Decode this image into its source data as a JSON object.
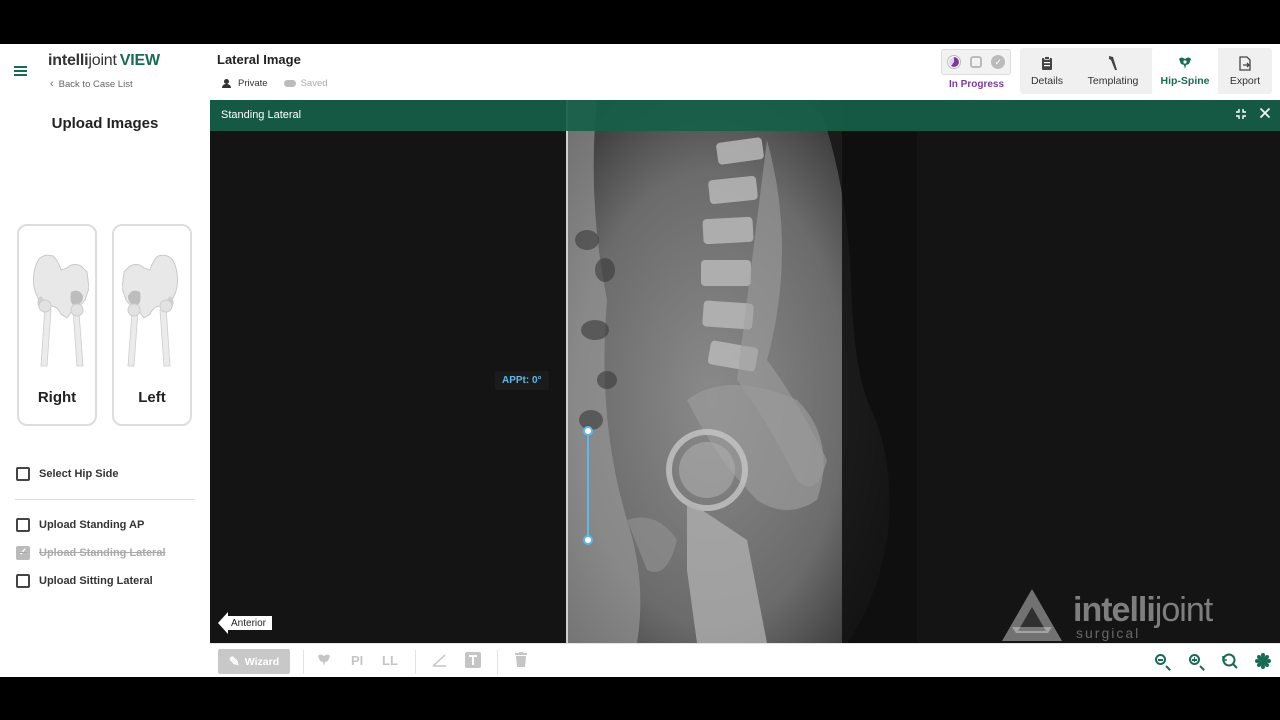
{
  "header": {
    "brand_bold": "intelli",
    "brand_light": "joint",
    "brand_view": "VIEW",
    "back_link": "Back to Case List",
    "doc_title": "Lateral Image",
    "privacy": "Private",
    "save_state": "Saved",
    "status": "In Progress",
    "tabs": [
      {
        "label": "Details",
        "icon": "clipboard-icon"
      },
      {
        "label": "Templating",
        "icon": "stem-icon"
      },
      {
        "label": "Hip-Spine",
        "icon": "hip-spine-icon"
      },
      {
        "label": "Export",
        "icon": "export-icon"
      }
    ],
    "active_tab": "Hip-Spine",
    "accent_color": "#1a6b55",
    "status_color": "#7a3c98"
  },
  "sidebar": {
    "title": "Upload Images",
    "hip_right": "Right",
    "hip_left": "Left",
    "checklist": [
      {
        "label": "Select Hip Side",
        "checked": false
      },
      {
        "label": "Upload Standing AP",
        "checked": false
      },
      {
        "label": "Upload Standing Lateral",
        "checked": true
      },
      {
        "label": "Upload Sitting Lateral",
        "checked": false
      }
    ]
  },
  "viewer": {
    "title": "Standing Lateral",
    "measurement": "APPt: 0°",
    "orientation": "Anterior",
    "watermark_bold": "intelli",
    "watermark_light": "joint",
    "watermark_sub": "surgical"
  },
  "toolbar": {
    "wizard": "Wizard",
    "pi": "PI",
    "ll": "LL",
    "tools": [
      "hip-tool-icon",
      "angle-icon",
      "text-tool-icon",
      "trash-icon"
    ],
    "right_tools": [
      "zoom-out-icon",
      "zoom-in-icon",
      "zoom-reset-icon",
      "brightness-icon"
    ]
  }
}
